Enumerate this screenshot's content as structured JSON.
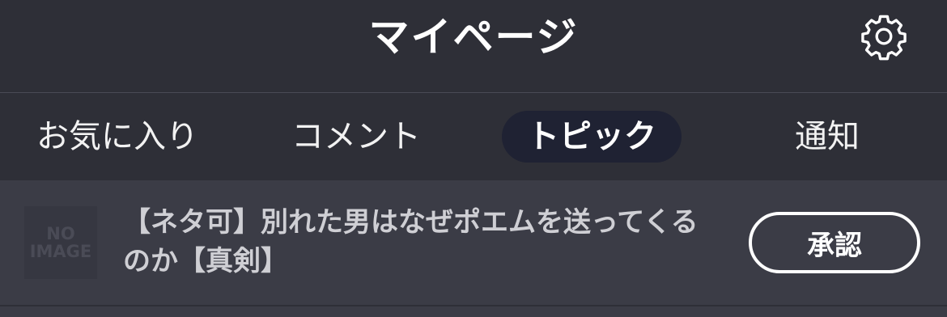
{
  "header": {
    "title": "マイページ",
    "settings_icon": "gear-icon"
  },
  "tabs": [
    {
      "label": "お気に入り",
      "active": false
    },
    {
      "label": "コメント",
      "active": false
    },
    {
      "label": "トピック",
      "active": true
    },
    {
      "label": "通知",
      "active": false
    }
  ],
  "items": [
    {
      "thumbnail_line1": "NO",
      "thumbnail_line2": "IMAGE",
      "title": "【ネタ可】別れた男はなぜポエムを送ってくるのか【真剣】",
      "action_label": "承認"
    }
  ],
  "colors": {
    "background": "#2e2f37",
    "list_background": "#3b3c46",
    "active_tab": "#1f2233",
    "text": "#ffffff"
  }
}
